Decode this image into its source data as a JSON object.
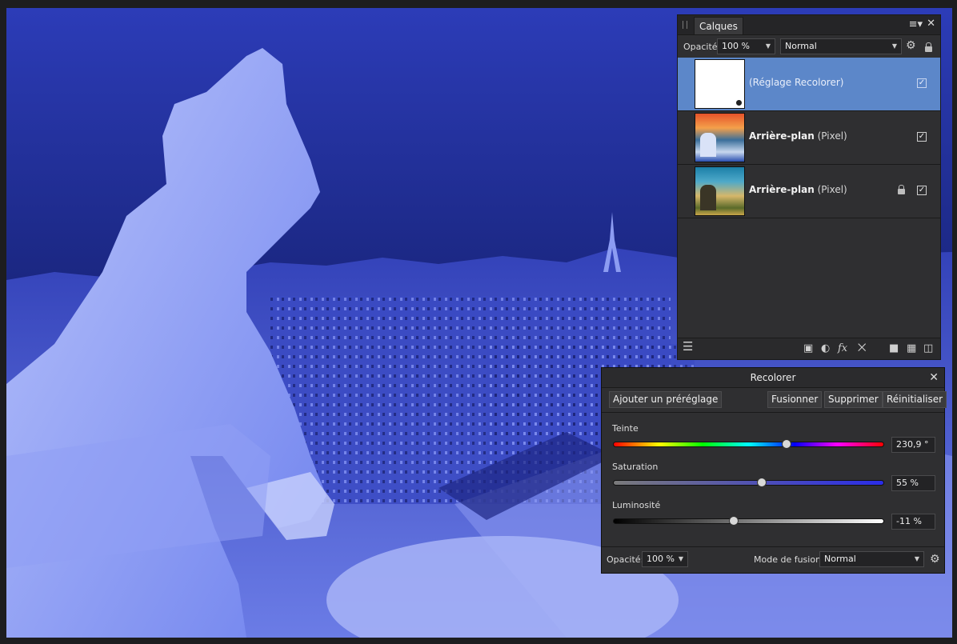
{
  "layers_panel": {
    "tab_label": "Calques",
    "opacity_label": "Opacité:",
    "opacity_value": "100 %",
    "blend_mode": "Normal",
    "layers": [
      {
        "name": "(Réglage Recolorer)",
        "type": "",
        "selected": true,
        "visible": true,
        "locked": false
      },
      {
        "name": "Arrière-plan",
        "type": "(Pixel)",
        "selected": false,
        "visible": true,
        "locked": false
      },
      {
        "name": "Arrière-plan",
        "type": "(Pixel)",
        "selected": false,
        "visible": true,
        "locked": true
      }
    ],
    "icons": [
      "panel-menu-icon",
      "close-icon",
      "gear-icon",
      "lock-icon",
      "layers-stack-icon",
      "mask-icon",
      "adjustment-icon",
      "fx-icon",
      "hourglass-icon",
      "folder-icon",
      "checkerboard-icon",
      "trash-icon"
    ]
  },
  "recolor_panel": {
    "title": "Recolorer",
    "buttons": {
      "add_preset": "Ajouter un préréglage",
      "merge": "Fusionner",
      "delete": "Supprimer",
      "reset": "Réinitialiser"
    },
    "hue": {
      "label": "Teinte",
      "value_text": "230,9 °",
      "fraction": 0.64
    },
    "saturation": {
      "label": "Saturation",
      "value_text": "55 %",
      "fraction": 0.55
    },
    "luminosity": {
      "label": "Luminosité",
      "value_text": "-11 %",
      "fraction": 0.445
    },
    "opacity_label": "Opacité:",
    "opacity_value": "100 %",
    "blend_mode_label": "Mode de fusion:",
    "blend_mode": "Normal"
  },
  "colors": {
    "selection": "#5c87c9",
    "panel_bg": "#2f2f31",
    "canvas_tint": "#3c4fd4"
  }
}
